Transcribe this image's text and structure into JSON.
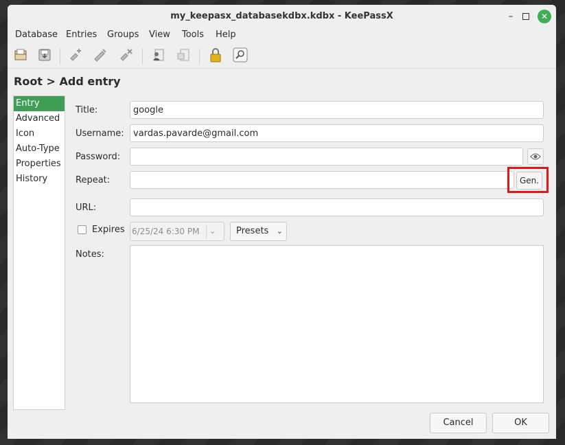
{
  "window": {
    "title": "my_keepasx_databasekdbx.kdbx - KeePassX"
  },
  "window_controls": {
    "minimize": "–",
    "close": "✕"
  },
  "menubar": {
    "items": [
      "Database",
      "Entries",
      "Groups",
      "View",
      "Tools",
      "Help"
    ]
  },
  "toolbar": {
    "icons": [
      "open-database-icon",
      "save-database-icon",
      "add-entry-icon",
      "edit-entry-icon",
      "delete-entry-icon",
      "copy-username-icon",
      "copy-password-icon",
      "lock-icon",
      "search-icon"
    ]
  },
  "page": {
    "breadcrumb": "Root > Add entry"
  },
  "categories": [
    "Entry",
    "Advanced",
    "Icon",
    "Auto-Type",
    "Properties",
    "History"
  ],
  "form": {
    "title_label": "Title:",
    "title_value": "google",
    "username_label": "Username:",
    "username_value": "vardas.pavarde@gmail.com",
    "password_label": "Password:",
    "password_value": "",
    "repeat_label": "Repeat:",
    "repeat_value": "",
    "gen_button": "Gen.",
    "url_label": "URL:",
    "url_value": "",
    "expires_label": "Expires",
    "expires_checked": false,
    "expires_date": "6/25/24 6:30 PM",
    "presets_label": "Presets",
    "notes_label": "Notes:",
    "notes_value": ""
  },
  "buttons": {
    "cancel": "Cancel",
    "ok": "OK"
  },
  "colors": {
    "accent": "#3e9e55",
    "highlight": "#e41515",
    "close_button": "#3fae55"
  }
}
